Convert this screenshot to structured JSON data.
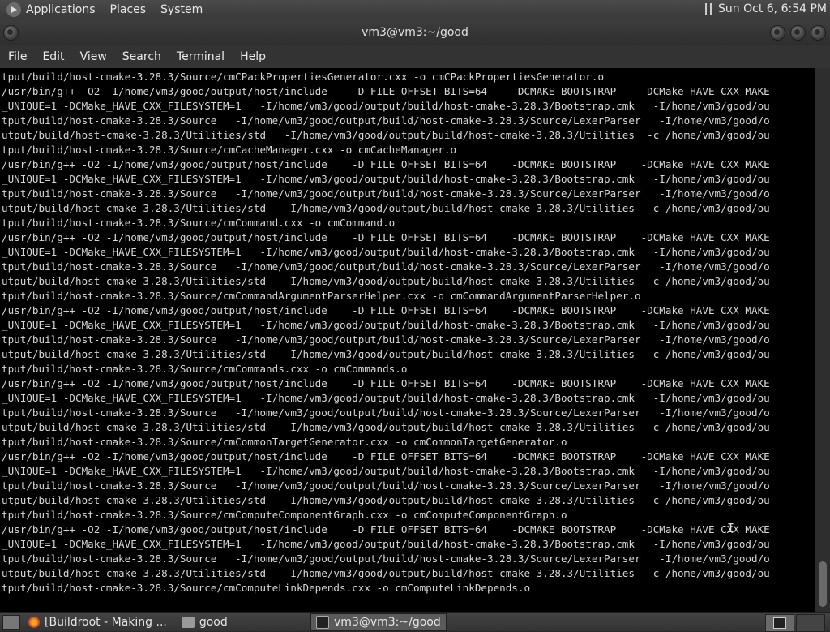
{
  "top_panel": {
    "menus": [
      "Applications",
      "Places",
      "System"
    ],
    "clock": "Sun Oct  6,  6:54 PM"
  },
  "window": {
    "title": "vm3@vm3:~/good",
    "menu": [
      "File",
      "Edit",
      "View",
      "Search",
      "Terminal",
      "Help"
    ]
  },
  "terminal": {
    "lines": [
      "tput/build/host-cmake-3.28.3/Source/cmCPackPropertiesGenerator.cxx -o cmCPackPropertiesGenerator.o",
      "/usr/bin/g++ -O2 -I/home/vm3/good/output/host/include    -D_FILE_OFFSET_BITS=64    -DCMAKE_BOOTSTRAP    -DCMake_HAVE_CXX_MAKE",
      "_UNIQUE=1 -DCMake_HAVE_CXX_FILESYSTEM=1   -I/home/vm3/good/output/build/host-cmake-3.28.3/Bootstrap.cmk   -I/home/vm3/good/ou",
      "tput/build/host-cmake-3.28.3/Source   -I/home/vm3/good/output/build/host-cmake-3.28.3/Source/LexerParser   -I/home/vm3/good/o",
      "utput/build/host-cmake-3.28.3/Utilities/std   -I/home/vm3/good/output/build/host-cmake-3.28.3/Utilities  -c /home/vm3/good/ou",
      "tput/build/host-cmake-3.28.3/Source/cmCacheManager.cxx -o cmCacheManager.o",
      "/usr/bin/g++ -O2 -I/home/vm3/good/output/host/include    -D_FILE_OFFSET_BITS=64    -DCMAKE_BOOTSTRAP    -DCMake_HAVE_CXX_MAKE",
      "_UNIQUE=1 -DCMake_HAVE_CXX_FILESYSTEM=1   -I/home/vm3/good/output/build/host-cmake-3.28.3/Bootstrap.cmk   -I/home/vm3/good/ou",
      "tput/build/host-cmake-3.28.3/Source   -I/home/vm3/good/output/build/host-cmake-3.28.3/Source/LexerParser   -I/home/vm3/good/o",
      "utput/build/host-cmake-3.28.3/Utilities/std   -I/home/vm3/good/output/build/host-cmake-3.28.3/Utilities  -c /home/vm3/good/ou",
      "tput/build/host-cmake-3.28.3/Source/cmCommand.cxx -o cmCommand.o",
      "/usr/bin/g++ -O2 -I/home/vm3/good/output/host/include    -D_FILE_OFFSET_BITS=64    -DCMAKE_BOOTSTRAP    -DCMake_HAVE_CXX_MAKE",
      "_UNIQUE=1 -DCMake_HAVE_CXX_FILESYSTEM=1   -I/home/vm3/good/output/build/host-cmake-3.28.3/Bootstrap.cmk   -I/home/vm3/good/ou",
      "tput/build/host-cmake-3.28.3/Source   -I/home/vm3/good/output/build/host-cmake-3.28.3/Source/LexerParser   -I/home/vm3/good/o",
      "utput/build/host-cmake-3.28.3/Utilities/std   -I/home/vm3/good/output/build/host-cmake-3.28.3/Utilities  -c /home/vm3/good/ou",
      "tput/build/host-cmake-3.28.3/Source/cmCommandArgumentParserHelper.cxx -o cmCommandArgumentParserHelper.o",
      "/usr/bin/g++ -O2 -I/home/vm3/good/output/host/include    -D_FILE_OFFSET_BITS=64    -DCMAKE_BOOTSTRAP    -DCMake_HAVE_CXX_MAKE",
      "_UNIQUE=1 -DCMake_HAVE_CXX_FILESYSTEM=1   -I/home/vm3/good/output/build/host-cmake-3.28.3/Bootstrap.cmk   -I/home/vm3/good/ou",
      "tput/build/host-cmake-3.28.3/Source   -I/home/vm3/good/output/build/host-cmake-3.28.3/Source/LexerParser   -I/home/vm3/good/o",
      "utput/build/host-cmake-3.28.3/Utilities/std   -I/home/vm3/good/output/build/host-cmake-3.28.3/Utilities  -c /home/vm3/good/ou",
      "tput/build/host-cmake-3.28.3/Source/cmCommands.cxx -o cmCommands.o",
      "/usr/bin/g++ -O2 -I/home/vm3/good/output/host/include    -D_FILE_OFFSET_BITS=64    -DCMAKE_BOOTSTRAP    -DCMake_HAVE_CXX_MAKE",
      "_UNIQUE=1 -DCMake_HAVE_CXX_FILESYSTEM=1   -I/home/vm3/good/output/build/host-cmake-3.28.3/Bootstrap.cmk   -I/home/vm3/good/ou",
      "tput/build/host-cmake-3.28.3/Source   -I/home/vm3/good/output/build/host-cmake-3.28.3/Source/LexerParser   -I/home/vm3/good/o",
      "utput/build/host-cmake-3.28.3/Utilities/std   -I/home/vm3/good/output/build/host-cmake-3.28.3/Utilities  -c /home/vm3/good/ou",
      "tput/build/host-cmake-3.28.3/Source/cmCommonTargetGenerator.cxx -o cmCommonTargetGenerator.o",
      "/usr/bin/g++ -O2 -I/home/vm3/good/output/host/include    -D_FILE_OFFSET_BITS=64    -DCMAKE_BOOTSTRAP    -DCMake_HAVE_CXX_MAKE",
      "_UNIQUE=1 -DCMake_HAVE_CXX_FILESYSTEM=1   -I/home/vm3/good/output/build/host-cmake-3.28.3/Bootstrap.cmk   -I/home/vm3/good/ou",
      "tput/build/host-cmake-3.28.3/Source   -I/home/vm3/good/output/build/host-cmake-3.28.3/Source/LexerParser   -I/home/vm3/good/o",
      "utput/build/host-cmake-3.28.3/Utilities/std   -I/home/vm3/good/output/build/host-cmake-3.28.3/Utilities  -c /home/vm3/good/ou",
      "tput/build/host-cmake-3.28.3/Source/cmComputeComponentGraph.cxx -o cmComputeComponentGraph.o",
      "/usr/bin/g++ -O2 -I/home/vm3/good/output/host/include    -D_FILE_OFFSET_BITS=64    -DCMAKE_BOOTSTRAP    -DCMake_HAVE_CXX_MAKE",
      "_UNIQUE=1 -DCMake_HAVE_CXX_FILESYSTEM=1   -I/home/vm3/good/output/build/host-cmake-3.28.3/Bootstrap.cmk   -I/home/vm3/good/ou",
      "tput/build/host-cmake-3.28.3/Source   -I/home/vm3/good/output/build/host-cmake-3.28.3/Source/LexerParser   -I/home/vm3/good/o",
      "utput/build/host-cmake-3.28.3/Utilities/std   -I/home/vm3/good/output/build/host-cmake-3.28.3/Utilities  -c /home/vm3/good/ou",
      "tput/build/host-cmake-3.28.3/Source/cmComputeLinkDepends.cxx -o cmComputeLinkDepends.o"
    ]
  },
  "taskbar": {
    "tasks": [
      {
        "label": "[Buildroot - Making ...",
        "icon": "firefox-icon"
      },
      {
        "label": "good",
        "icon": "folder-icon"
      },
      {
        "label": "vm3@vm3:~/good",
        "icon": "terminal-icon",
        "active": true
      }
    ]
  }
}
